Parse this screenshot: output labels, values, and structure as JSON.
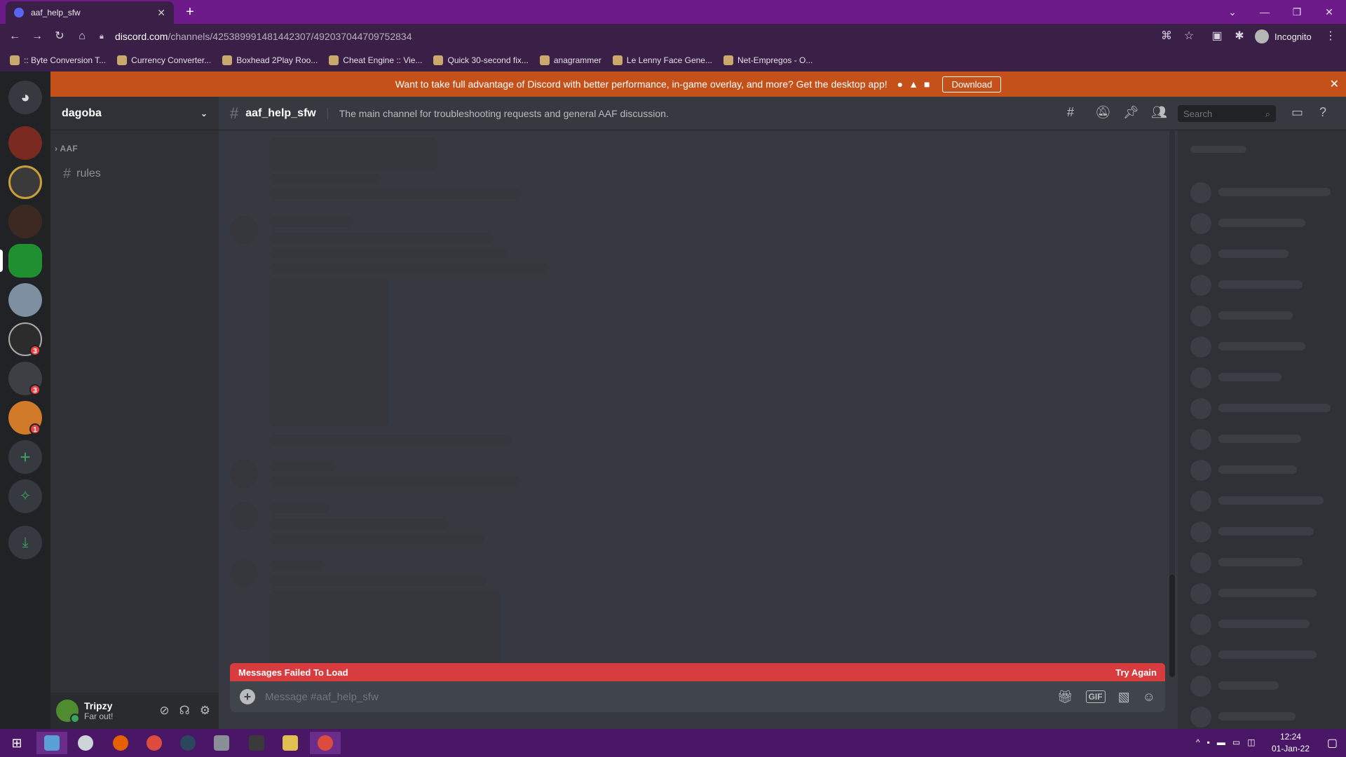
{
  "browser": {
    "tab_title": "aaf_help_sfw",
    "url_host": "discord.com",
    "url_path": "/channels/425389991481442307/492037044709752834",
    "incognito_label": "Incognito",
    "bookmarks": [
      ":: Byte Conversion T...",
      "Currency Converter...",
      "Boxhead 2Play Roo...",
      "Cheat Engine :: Vie...",
      "Quick 30-second fix...",
      "anagrammer",
      "Le Lenny Face Gene...",
      "Net-Empregos - O..."
    ]
  },
  "notice": {
    "text": "Want to take full advantage of Discord with better performance, in-game overlay, and more? Get the desktop app!",
    "download_label": "Download"
  },
  "server": {
    "name": "dagoba",
    "category": "AAF",
    "channels": [
      "rules"
    ]
  },
  "guild_badges": [
    "3",
    "3",
    "1"
  ],
  "channel": {
    "name": "aaf_help_sfw",
    "topic": "The main channel for troubleshooting requests and general AAF discussion."
  },
  "search_placeholder": "Search",
  "error": {
    "message": "Messages Failed To Load",
    "retry": "Try Again"
  },
  "composer": {
    "placeholder": "Message #aaf_help_sfw"
  },
  "user": {
    "name": "Tripzy",
    "status": "Far out!"
  },
  "taskbar": {
    "time": "12:24",
    "date": "01-Jan-22"
  },
  "colors": {
    "browser_frame": "#6d1b8a",
    "notice_bg": "#c4501a",
    "error_bg": "#d83c3e",
    "discord_bg": "#36393f"
  }
}
